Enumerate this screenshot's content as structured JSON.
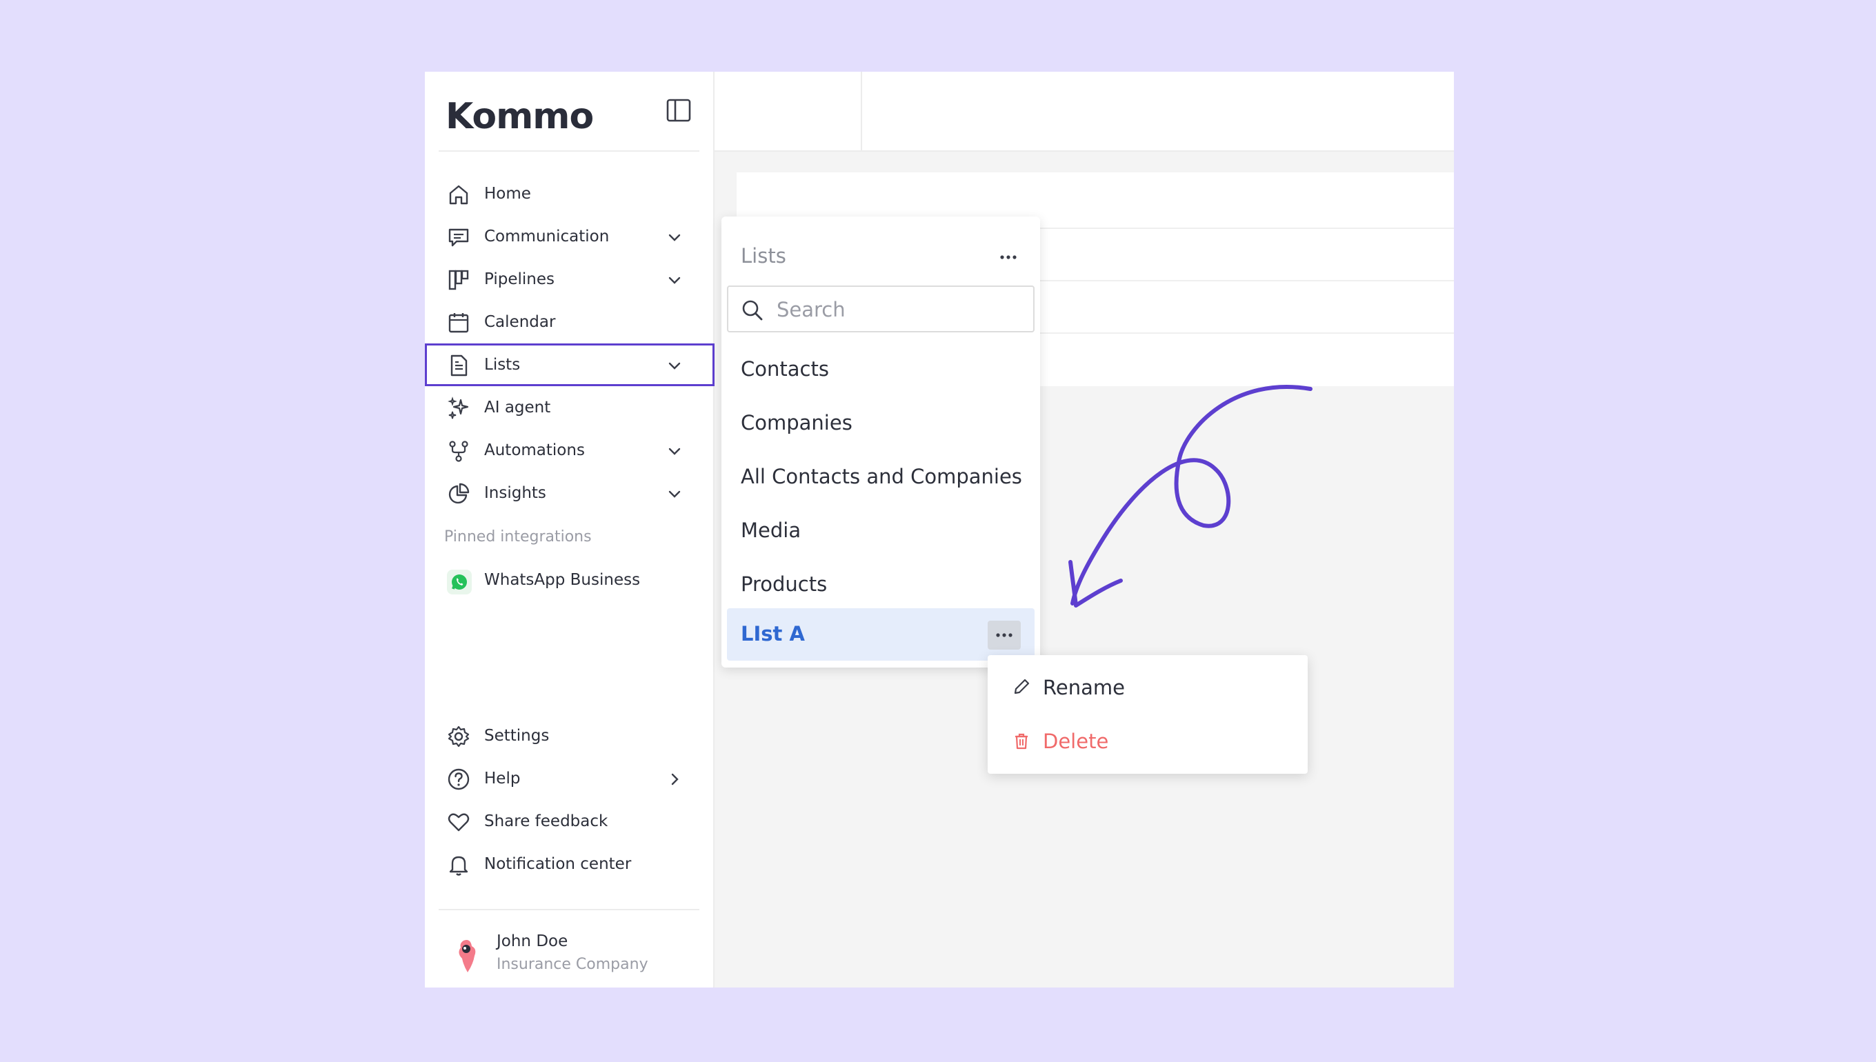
{
  "app": {
    "logo_text": "Kommo"
  },
  "sidebar": {
    "items": [
      {
        "label": "Home",
        "icon": "home-icon",
        "chevron": false
      },
      {
        "label": "Communication",
        "icon": "chat-icon",
        "chevron": true
      },
      {
        "label": "Pipelines",
        "icon": "pipeline-icon",
        "chevron": true
      },
      {
        "label": "Calendar",
        "icon": "calendar-icon",
        "chevron": false
      },
      {
        "label": "Lists",
        "icon": "document-icon",
        "chevron": true,
        "active": true
      },
      {
        "label": "AI agent",
        "icon": "sparkle-icon",
        "chevron": false
      },
      {
        "label": "Automations",
        "icon": "flow-icon",
        "chevron": true
      },
      {
        "label": "Insights",
        "icon": "pie-chart-icon",
        "chevron": true
      }
    ],
    "pinned_title": "Pinned integrations",
    "pinned_items": [
      {
        "label": "WhatsApp Business",
        "icon": "whatsapp-icon"
      }
    ],
    "bottom_items": [
      {
        "label": "Settings",
        "icon": "gear-icon"
      },
      {
        "label": "Help",
        "icon": "help-icon"
      },
      {
        "label": "Share feedback",
        "icon": "heart-icon"
      },
      {
        "label": "Notification center",
        "icon": "bell-icon"
      }
    ],
    "user": {
      "name": "John Doe",
      "company": "Insurance Company"
    }
  },
  "lists_panel": {
    "title": "Lists",
    "search_placeholder": "Search",
    "items": [
      "Contacts",
      "Companies",
      "All Contacts and Companies",
      "Media",
      "Products"
    ],
    "active_item": "LIst A"
  },
  "context_menu": {
    "rename": "Rename",
    "delete": "Delete"
  },
  "colors": {
    "background": "#e3defd",
    "accent": "#5d3fcf",
    "active_item_text": "#2f68d1",
    "delete_red": "#f06a6a"
  }
}
